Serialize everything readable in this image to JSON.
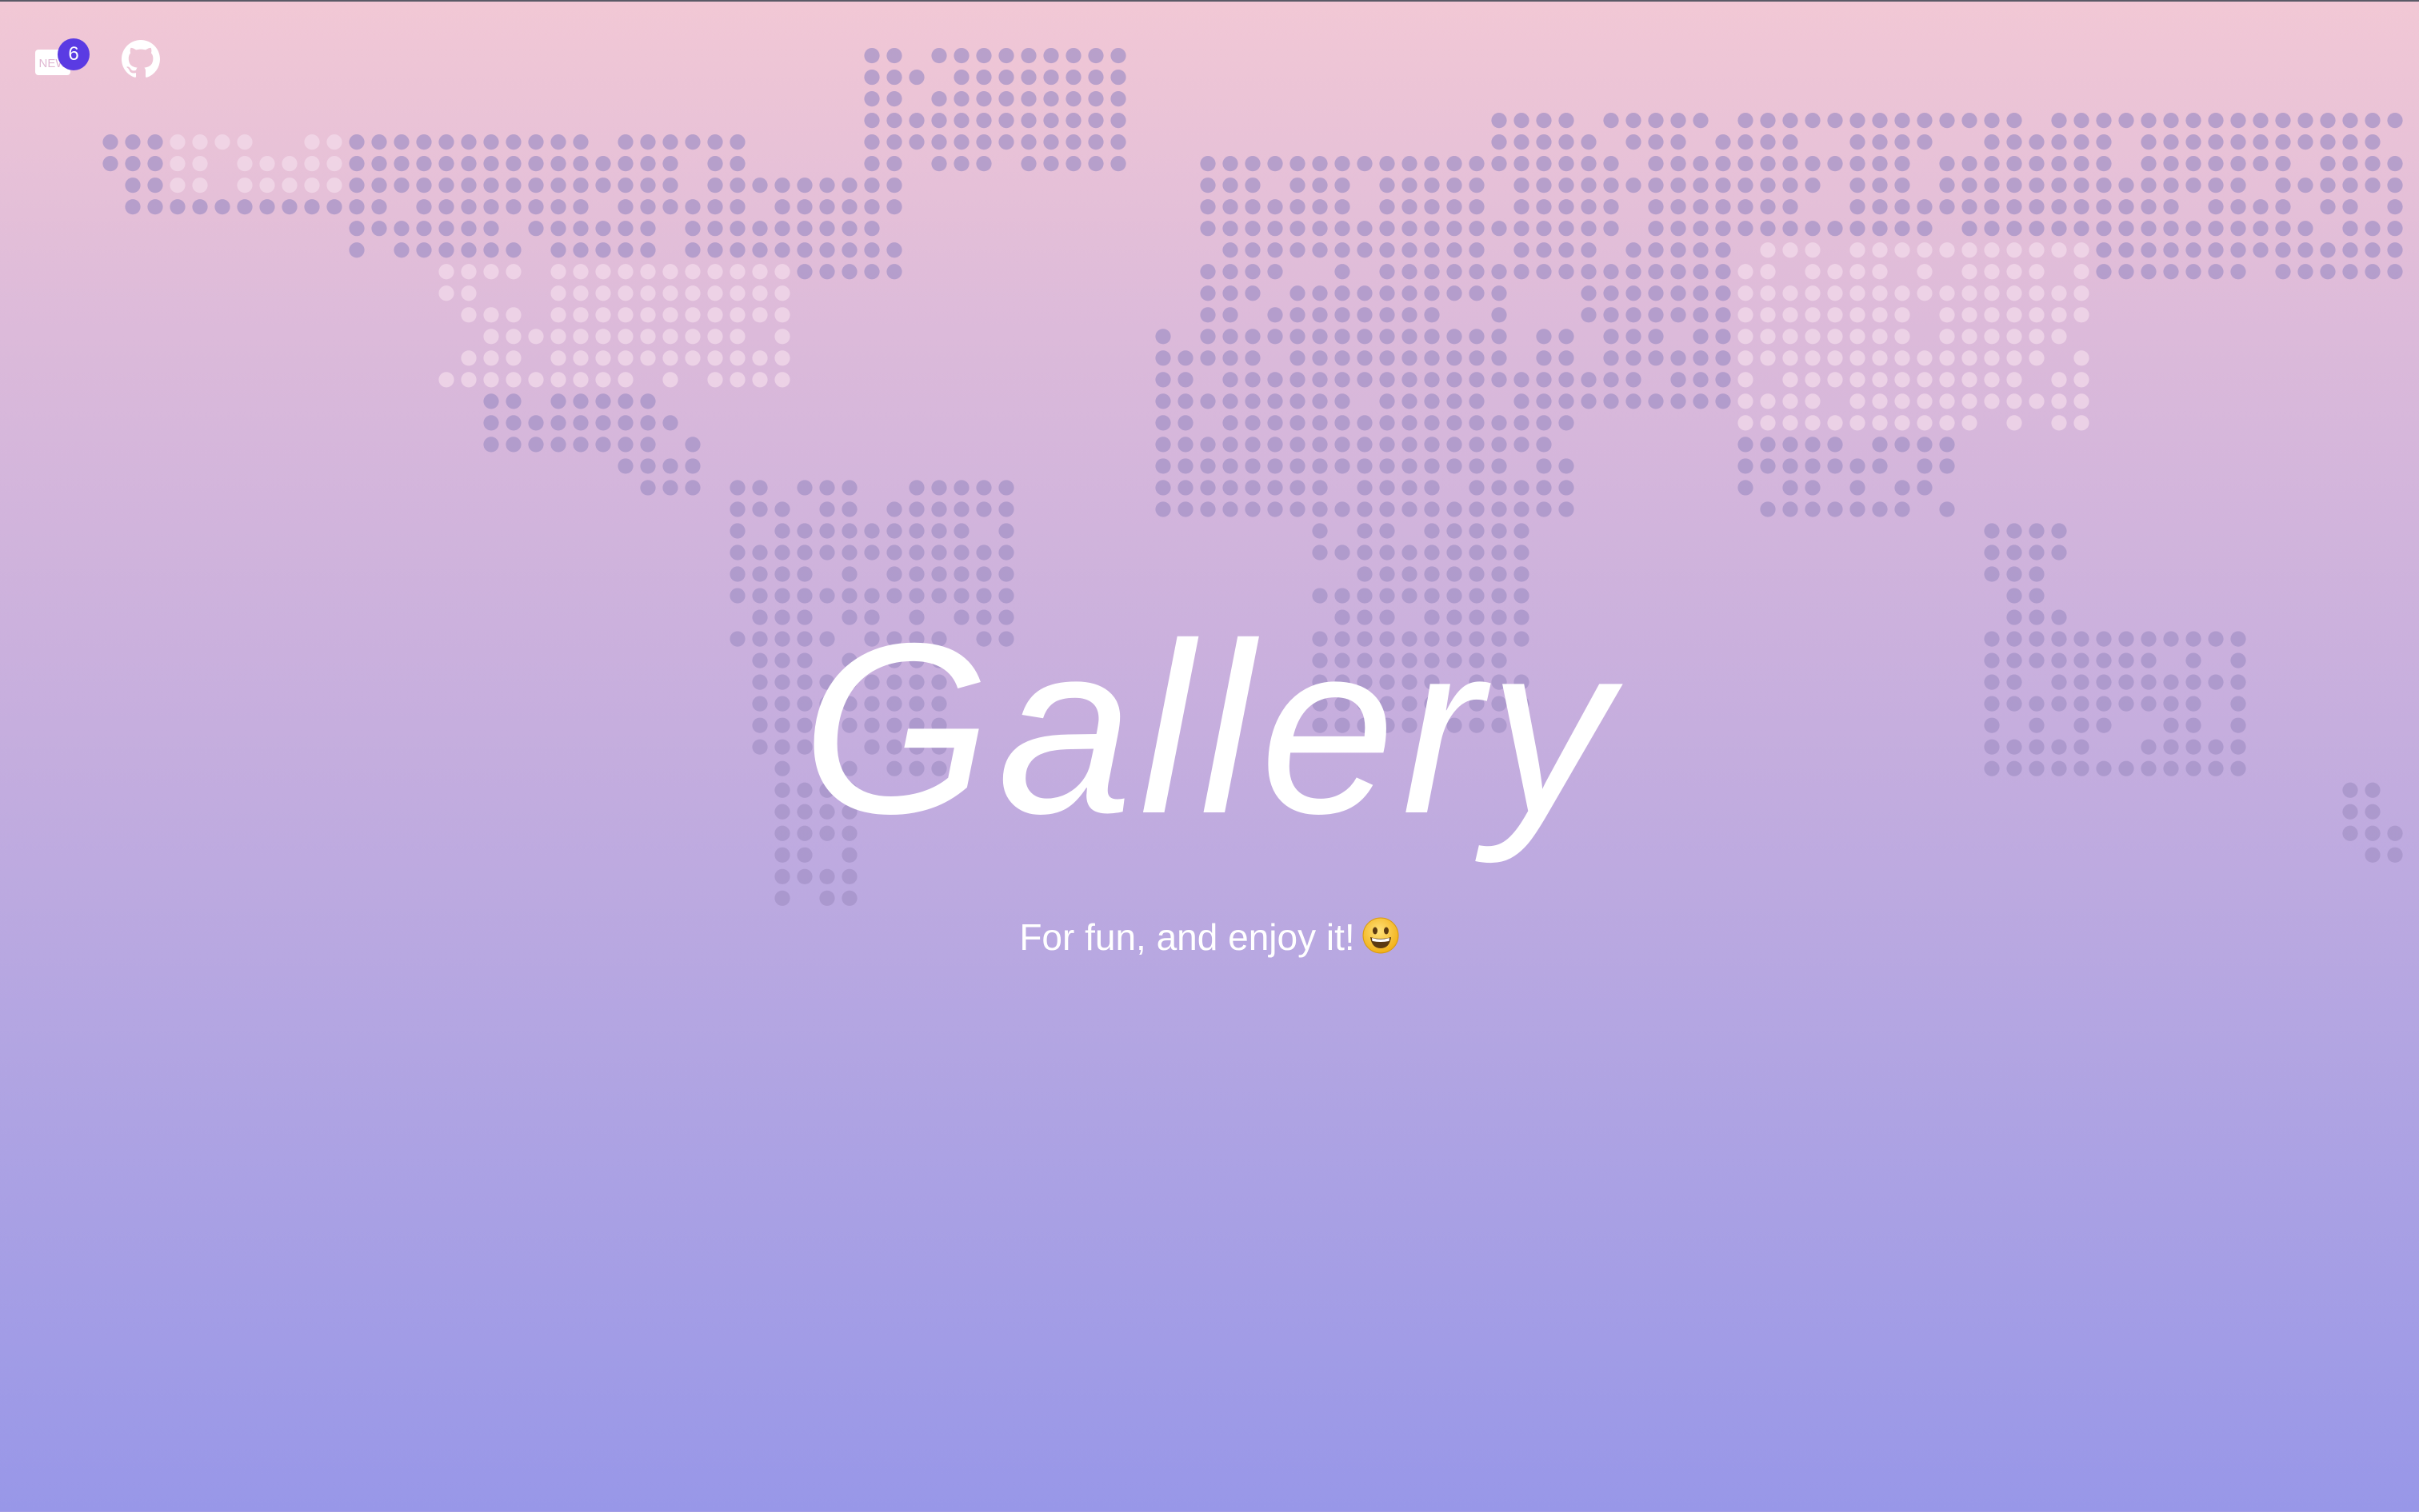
{
  "topbar": {
    "news_icon": "news-icon",
    "news_badge_text": "NEW",
    "news_count": "6",
    "github_icon": "github-icon"
  },
  "hero": {
    "title": "Gallery",
    "subtitle": "For fun, and enjoy it!",
    "emoji_icon": "grinning-face-emoji"
  },
  "background": {
    "gradient": [
      "#f2c8d5",
      "#dcbada",
      "#c6aede",
      "#aea3e3",
      "#9897e8"
    ],
    "map_dot_color": "#a895c4",
    "map_highlight_dot_color": "#f1d6e6",
    "badge_color": "#5a3be3"
  }
}
